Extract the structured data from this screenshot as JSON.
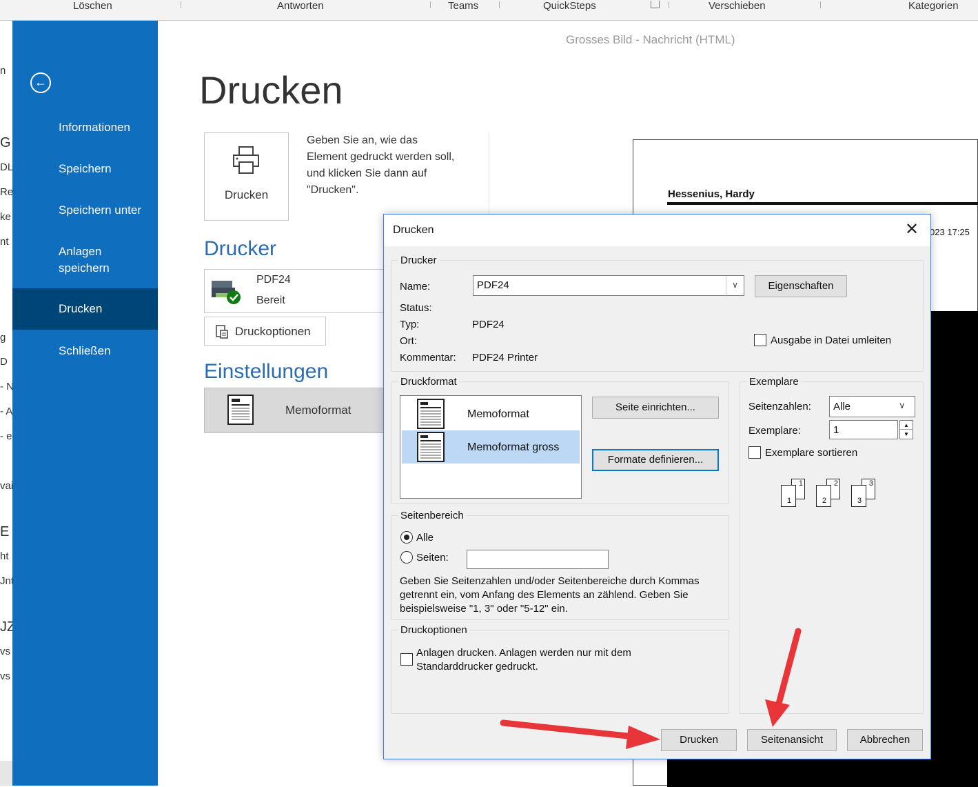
{
  "ribbon": {
    "groups": [
      "Löschen",
      "Antworten",
      "Teams",
      "QuickSteps",
      "Verschieben",
      "Kategorien"
    ]
  },
  "left_pane_fragments": [
    "n",
    "G",
    "DL",
    "Re",
    "ke",
    "nt",
    "g",
    "D",
    "- N",
    "- A",
    "- e",
    "vai",
    "E",
    "ht",
    "Jnt",
    "JZ",
    "vs S",
    "vs I"
  ],
  "backstage": {
    "back_icon": "arrow-left-circle-icon",
    "nav": [
      {
        "label": "Informationen",
        "active": false
      },
      {
        "label": "Speichern",
        "active": false
      },
      {
        "label": "Speichern unter",
        "active": false
      },
      {
        "label": "Anlagen speichern",
        "active": false
      },
      {
        "label": "Drucken",
        "active": true
      },
      {
        "label": "Schließen",
        "active": false
      }
    ]
  },
  "main": {
    "window_caption": "Grosses Bild  -  Nachricht (HTML)",
    "title": "Drucken",
    "print_tile_label": "Drucken",
    "print_description": "Geben Sie an, wie das Element gedruckt werden soll, und klicken Sie dann auf \"Drucken\".",
    "printer_heading": "Drucker",
    "printer_name": "PDF24",
    "printer_status": "Bereit",
    "print_options_label": "Druckoptionen",
    "settings_heading": "Einstellungen",
    "format_tile_label": "Memoformat"
  },
  "preview": {
    "sender": "Hessenius, Hardy",
    "date_fragment": "023 17:25"
  },
  "dialog": {
    "title": "Drucken",
    "printer_group": "Drucker",
    "name_label": "Name:",
    "name_value": "PDF24",
    "properties_button": "Eigenschaften",
    "status_label": "Status:",
    "type_label": "Typ:",
    "type_value": "PDF24",
    "location_label": "Ort:",
    "comment_label": "Kommentar:",
    "comment_value": "PDF24 Printer",
    "redirect_label": "Ausgabe in Datei umleiten",
    "format_group": "Druckformat",
    "formats": [
      {
        "label": "Memoformat",
        "selected": false
      },
      {
        "label": "Memoformat gross",
        "selected": true
      }
    ],
    "page_setup_button": "Seite einrichten...",
    "define_formats_button": "Formate definieren...",
    "copies_group": "Exemplare",
    "page_numbers_label": "Seitenzahlen:",
    "page_numbers_value": "Alle",
    "copies_label": "Exemplare:",
    "copies_value": "1",
    "collate_label": "Exemplare sortieren",
    "collate_digits": [
      "1",
      "1",
      "2",
      "2",
      "3",
      "3"
    ],
    "range_group": "Seitenbereich",
    "range_all": "Alle",
    "range_pages": "Seiten:",
    "range_hint": "Geben Sie Seitenzahlen und/oder Seitenbereiche durch Kommas getrennt ein, vom Anfang des Elements an zählend. Geben Sie beispielsweise \"1, 3\" oder \"5-12\" ein.",
    "options_group": "Druckoptionen",
    "attachments_label": "Anlagen drucken. Anlagen werden nur mit dem Standarddrucker gedruckt.",
    "print_button": "Drucken",
    "preview_button": "Seitenansicht",
    "cancel_button": "Abbrechen"
  },
  "colors": {
    "sidebar": "#106ebe",
    "sidebar_active": "#004578",
    "accent": "#2b6cb0",
    "arrow": "#e8353a"
  }
}
